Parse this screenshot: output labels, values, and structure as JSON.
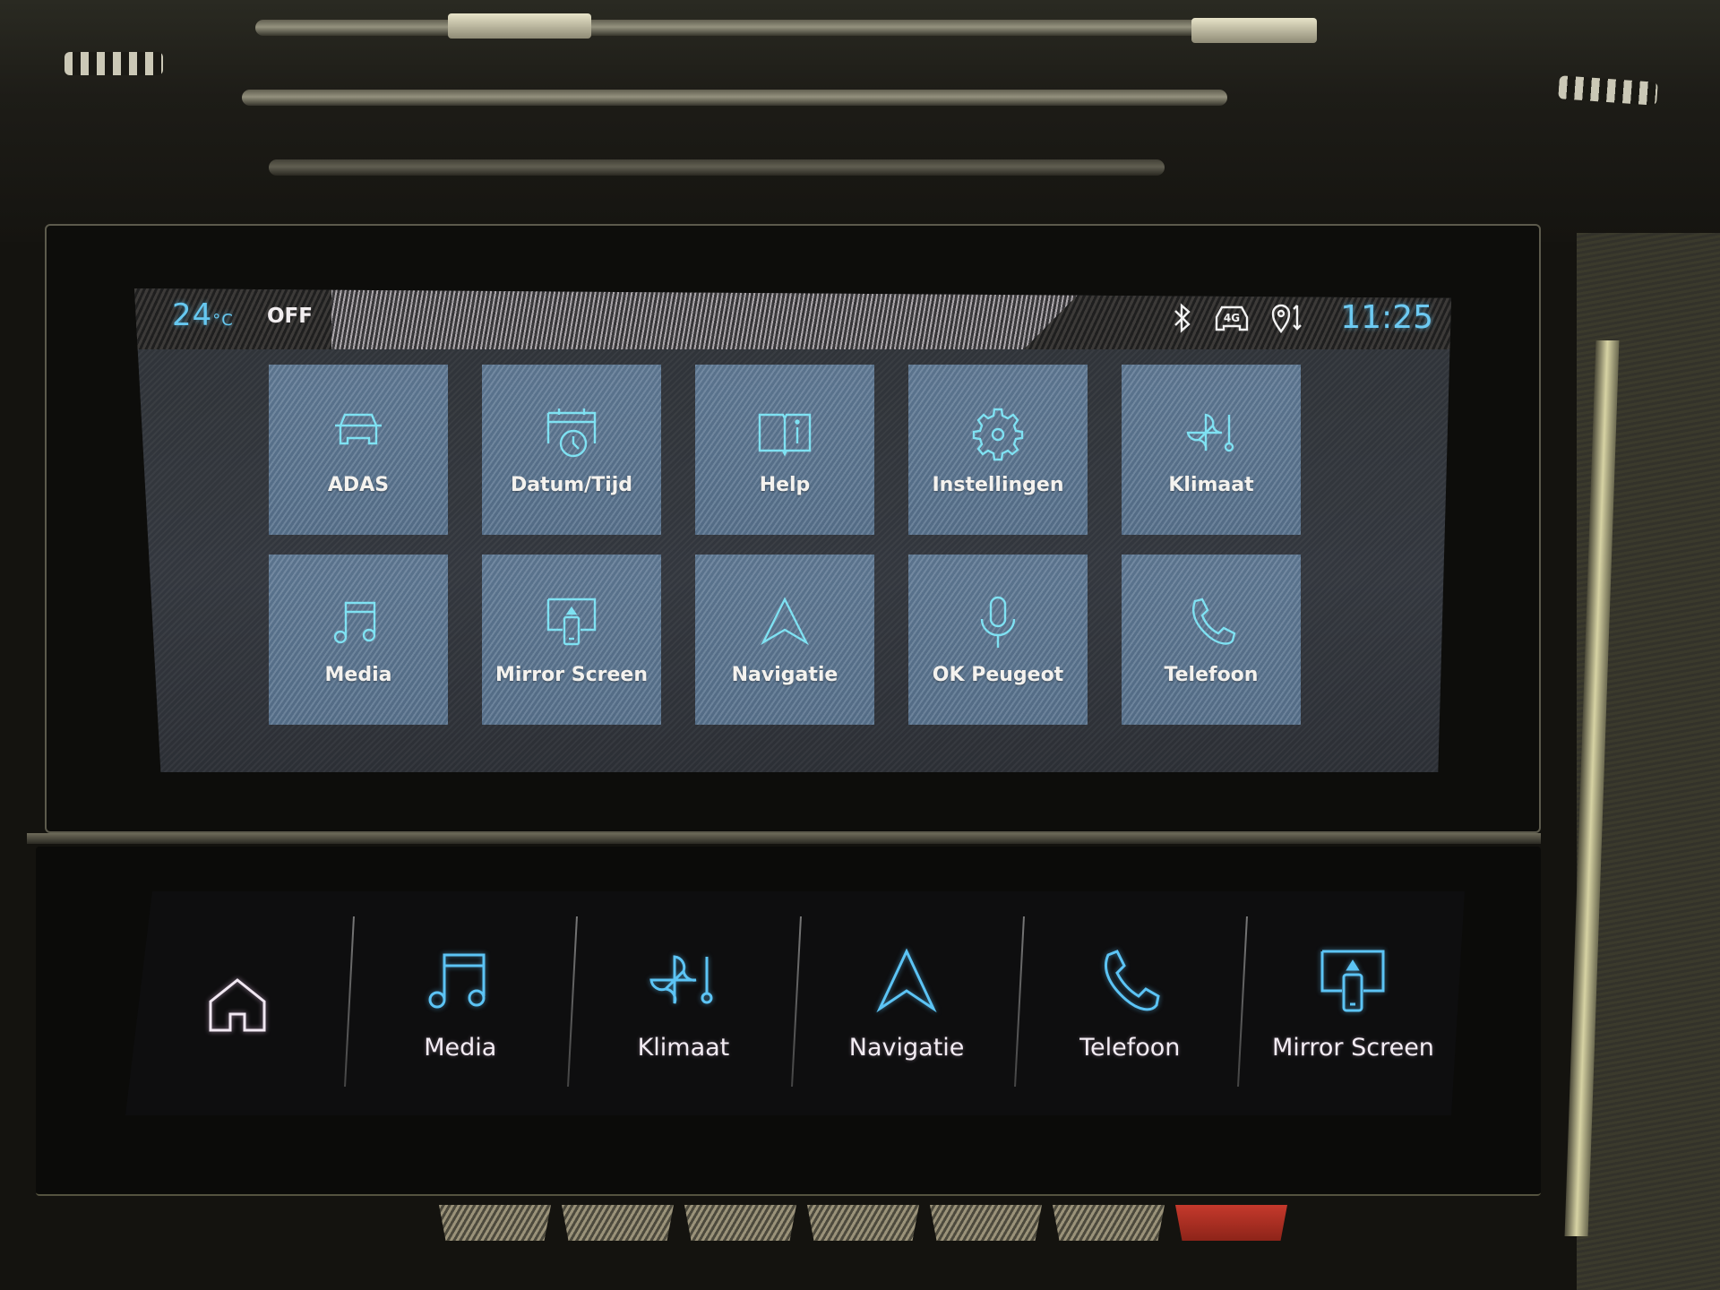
{
  "status_bar": {
    "temperature": "24",
    "temperature_unit": "°C",
    "ac_status": "OFF",
    "icons": [
      "bluetooth-icon",
      "4g-car-connectivity-icon",
      "location-sync-icon"
    ],
    "network_label": "4G",
    "clock": "11:25",
    "accent_color": "#6dcaf2"
  },
  "app_grid": {
    "tiles": [
      {
        "label": "ADAS",
        "icon": "car-icon"
      },
      {
        "label": "Datum/Tijd",
        "icon": "calendar-clock-icon"
      },
      {
        "label": "Help",
        "icon": "book-info-icon"
      },
      {
        "label": "Instellingen",
        "icon": "gear-icon"
      },
      {
        "label": "Klimaat",
        "icon": "fan-thermometer-icon"
      },
      {
        "label": "Media",
        "icon": "music-note-icon"
      },
      {
        "label": "Mirror Screen",
        "icon": "mirror-screen-icon"
      },
      {
        "label": "Navigatie",
        "icon": "navigation-arrow-icon"
      },
      {
        "label": "OK Peugeot",
        "icon": "microphone-icon"
      },
      {
        "label": "Telefoon",
        "icon": "phone-icon"
      }
    ],
    "tile_color": "#5b7590",
    "icon_color": "#7fe1f2"
  },
  "touch_bar": {
    "items": [
      {
        "label": "",
        "icon": "home-icon"
      },
      {
        "label": "Media",
        "icon": "music-note-icon"
      },
      {
        "label": "Klimaat",
        "icon": "fan-thermometer-icon"
      },
      {
        "label": "Navigatie",
        "icon": "navigation-arrow-icon"
      },
      {
        "label": "Telefoon",
        "icon": "phone-icon"
      },
      {
        "label": "Mirror Screen",
        "icon": "mirror-screen-icon"
      }
    ],
    "icon_color": "#5cc4f5"
  },
  "physical_buttons": {
    "count": 7,
    "hazard_color": "#c5392c"
  }
}
